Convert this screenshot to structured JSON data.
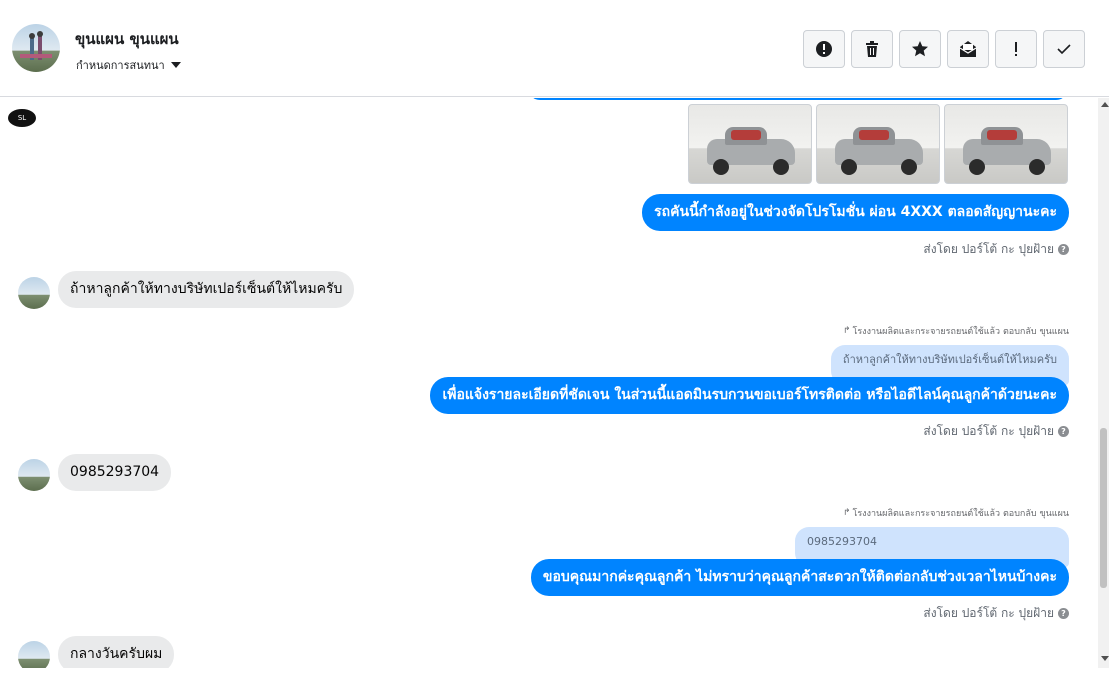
{
  "header": {
    "contact_name": "ขุนแผน ขุนแผน",
    "assign_label": "กำหนดการสนทนา",
    "actions": [
      {
        "name": "report-icon"
      },
      {
        "name": "trash-icon"
      },
      {
        "name": "star-icon"
      },
      {
        "name": "mark-unread-icon"
      },
      {
        "name": "important-icon"
      },
      {
        "name": "check-icon"
      }
    ]
  },
  "messages": {
    "page_logo_text": "SL",
    "out_1": "รถคันนี้กำลังอยู่ในช่วงจัดโปรโมชั่น ผ่อน 4XXX ตลอดสัญญานะคะ",
    "sent_by_1": "ส่งโดย ปอร์โต้ กะ ปุยฝ้าย",
    "in_1": "ถ้าหาลูกค้าให้ทางบริษัทเปอร์เซ็นต์ให้ไหมครับ",
    "reply_note_1": "โรงงานผลิตและกระจายรถยนต์ใช้แล้ว ตอบกลับ ขุนแผน",
    "quote_1": "ถ้าหาลูกค้าให้ทางบริษัทเปอร์เซ็นต์ให้ไหมครับ",
    "out_2": "เพื่อแจ้งรายละเอียดที่ชัดเจน ในส่วนนี้แอดมินรบกวนขอเบอร์โทรติดต่อ หรือไอดีไลน์คุณลูกค้าด้วยนะคะ",
    "sent_by_2": "ส่งโดย ปอร์โต้ กะ ปุยฝ้าย",
    "in_2": "0985293704",
    "reply_note_2": "โรงงานผลิตและกระจายรถยนต์ใช้แล้ว ตอบกลับ ขุนแผน",
    "quote_2": "0985293704",
    "out_3": "ขอบคุณมากค่ะคุณลูกค้า ไม่ทราบว่าคุณลูกค้าสะดวกให้ติดต่อกลับช่วงเวลาไหนบ้างคะ",
    "sent_by_3": "ส่งโดย ปอร์โต้ กะ ปุยฝ้าย",
    "in_3": "กลางวันครับผม",
    "help_glyph": "?"
  },
  "colors": {
    "outgoing": "#0084ff",
    "incoming": "#e9eaeb",
    "quote": "#cfe3fd"
  }
}
